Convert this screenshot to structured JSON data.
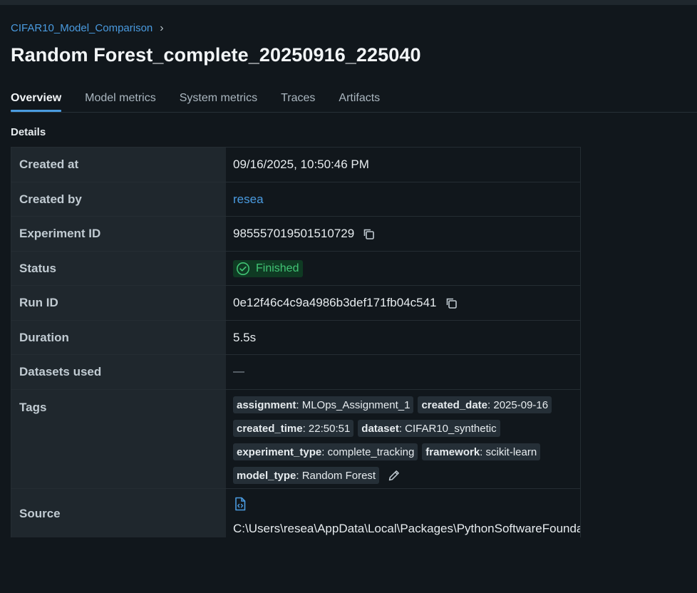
{
  "breadcrumb": {
    "experiment": "CIFAR10_Model_Comparison"
  },
  "page": {
    "title": "Random Forest_complete_20250916_225040"
  },
  "tabs": [
    {
      "label": "Overview",
      "active": true
    },
    {
      "label": "Model metrics",
      "active": false
    },
    {
      "label": "System metrics",
      "active": false
    },
    {
      "label": "Traces",
      "active": false
    },
    {
      "label": "Artifacts",
      "active": false
    }
  ],
  "details": {
    "section_label": "Details",
    "created_at": {
      "key": "Created at",
      "value": "09/16/2025, 10:50:46 PM"
    },
    "created_by": {
      "key": "Created by",
      "value": "resea"
    },
    "experiment_id": {
      "key": "Experiment ID",
      "value": "985557019501510729",
      "icon": "copy-icon"
    },
    "status": {
      "key": "Status",
      "value": "Finished",
      "icon": "check-circle-icon",
      "color": "#41c475"
    },
    "run_id": {
      "key": "Run ID",
      "value": "0e12f46c4c9a4986b3def171fb04c541",
      "icon": "copy-icon"
    },
    "duration": {
      "key": "Duration",
      "value": "5.5s"
    },
    "datasets_used": {
      "key": "Datasets used",
      "value": "—"
    },
    "tags": {
      "key": "Tags",
      "items": [
        {
          "name": "assignment",
          "value": "MLOps_Assignment_1"
        },
        {
          "name": "created_date",
          "value": "2025-09-16"
        },
        {
          "name": "created_time",
          "value": "22:50:51"
        },
        {
          "name": "dataset",
          "value": "CIFAR10_synthetic"
        },
        {
          "name": "experiment_type",
          "value": "complete_tracking"
        },
        {
          "name": "framework",
          "value": "scikit-learn"
        },
        {
          "name": "model_type",
          "value": "Random Forest"
        }
      ],
      "edit_icon": "pencil-icon"
    },
    "source": {
      "key": "Source",
      "icon": "file-code-icon",
      "value": "C:\\Users\\resea\\AppData\\Local\\Packages\\PythonSoftwareFounda"
    }
  },
  "colors": {
    "accent": "#4a9be0",
    "background": "#11171c",
    "key_cell": "#1f272d",
    "success": "#41c475"
  }
}
